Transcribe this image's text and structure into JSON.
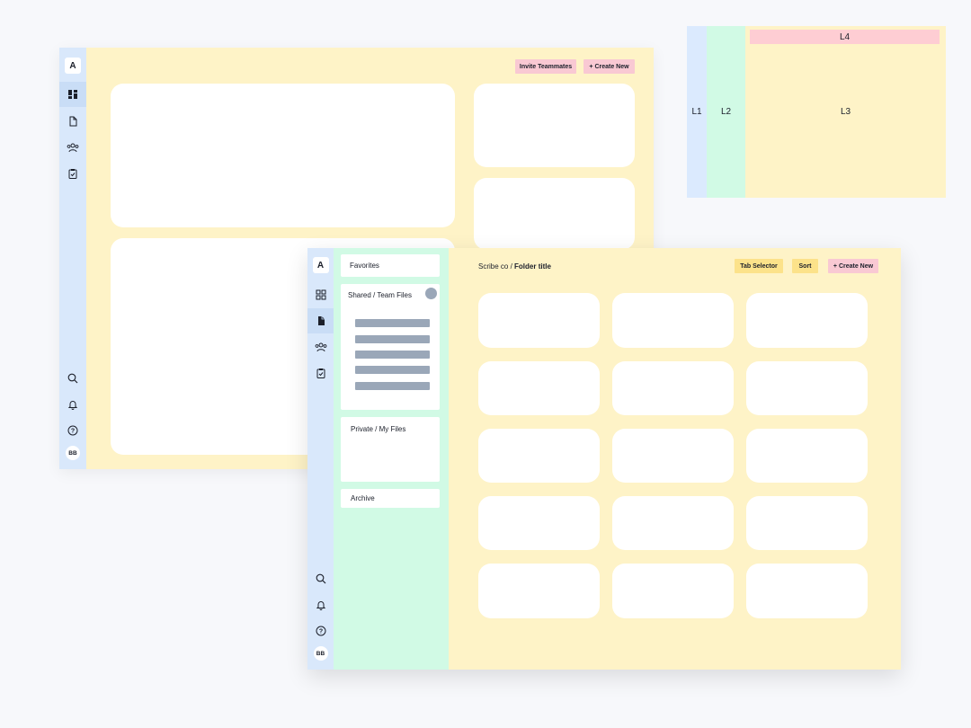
{
  "back_window": {
    "logo": "A",
    "avatar": "BB",
    "buttons": {
      "invite_label": "Invite Teammates",
      "create_label": "+ Create New"
    }
  },
  "layout_legend": {
    "l1": "L1",
    "l2": "L2",
    "l3": "L3",
    "l4": "L4"
  },
  "front_window": {
    "logo": "A",
    "avatar": "BB",
    "breadcrumb": {
      "parent": "Scribe co /",
      "current": "Folder title"
    },
    "buttons": {
      "tab_selector_label": "Tab Selector",
      "sort_label": "Sort",
      "create_label": "+ Create New"
    },
    "folders": {
      "favorites": "Favorites",
      "shared": "Shared / Team Files",
      "private": "Private / My Files",
      "archive": "Archive"
    }
  },
  "icons": {
    "rail_top": [
      "dashboard-icon",
      "document-icon",
      "users-icon",
      "clipboard-check-icon"
    ],
    "rail_bottom": [
      "search-icon",
      "bell-icon",
      "help-icon"
    ]
  },
  "colors": {
    "rail": "#d9e8fb",
    "main_bg": "#fef3c7",
    "folder_panel": "#d1fae5",
    "pink_button": "#f9c9d3",
    "gold_button": "#fce28a"
  }
}
